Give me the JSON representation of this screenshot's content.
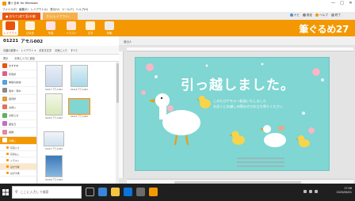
{
  "window": {
    "title": "筆ぐるめ for Windows",
    "controls": [
      "—",
      "□",
      "✕"
    ]
  },
  "menu": [
    "ファイル(F)",
    "編集(E)",
    "レイアウト(L)",
    "表示(V)",
    "ツール(T)",
    "ヘルプ(H)"
  ],
  "mode_tabs": [
    {
      "label": "● おもて(宛て面)を編集",
      "active": true
    },
    {
      "label": "うら(レイアウト)",
      "active": false
    }
  ],
  "top_links": [
    {
      "label": "ナビ",
      "color": "#4a90d9"
    },
    {
      "label": "設定",
      "color": "#888888"
    },
    {
      "label": "ヘルプ",
      "color": "#f39800"
    },
    {
      "label": "終了",
      "color": "#999999"
    }
  ],
  "ribbon": {
    "buttons": [
      {
        "label": "レイアウト",
        "icon": "layout-icon",
        "color": "#e8540c",
        "active": true
      },
      {
        "label": "ひな形",
        "icon": "template-icon",
        "color": "#e8540c",
        "active": false
      },
      {
        "label": "写真",
        "icon": "photo-icon",
        "color": "#d23f7a",
        "active": false
      },
      {
        "label": "イラスト",
        "icon": "illust-icon",
        "color": "#d24a2c",
        "active": false
      },
      {
        "label": "文字",
        "icon": "text-icon",
        "color": "#7a4a2a",
        "active": false
      },
      {
        "label": "印刷",
        "icon": "print-icon",
        "color": "#3a3a3a",
        "active": false
      }
    ],
    "brand": "筆ぐるめ27"
  },
  "layout": {
    "number": "01221",
    "name": "アモル002"
  },
  "right_caption": "差出人",
  "subtoolbar": [
    "引越の挨拶 ▾",
    "レイアウト ▾",
    "手書き文字",
    "お気に入り",
    "すべて"
  ],
  "subtoolbar2": [
    "表示",
    "お気に入りに追加"
  ],
  "categories": [
    {
      "label": "おすすめ",
      "color": "#e8540c",
      "sel": false,
      "sub": false
    },
    {
      "label": "年賀状",
      "color": "#e06080",
      "sel": false,
      "sub": false
    },
    {
      "label": "季節の挨拶",
      "color": "#5aa0d8",
      "sel": false,
      "sub": false
    },
    {
      "label": "喪中・寒中",
      "color": "#8a8a8a",
      "sel": false,
      "sub": false
    },
    {
      "label": "招待状",
      "color": "#d8a040",
      "sel": false,
      "sub": false
    },
    {
      "label": "お祝い",
      "color": "#e07060",
      "sel": false,
      "sub": false
    },
    {
      "label": "お知らせ",
      "color": "#60b060",
      "sel": false,
      "sub": false
    },
    {
      "label": "誕生日",
      "color": "#c070c0",
      "sel": false,
      "sub": false
    },
    {
      "label": "結婚",
      "color": "#e08aa0",
      "sel": false,
      "sub": false
    },
    {
      "label": "引越し",
      "color": "#ffffff",
      "sel": true,
      "sub": false
    },
    {
      "label": "写真入り",
      "color": "#f39800",
      "sel": false,
      "sub": true
    },
    {
      "label": "写真なし",
      "color": "#f39800",
      "sel": false,
      "sub": true
    },
    {
      "label": "イラスト",
      "color": "#f39800",
      "sel": false,
      "sub": true
    },
    {
      "label": "はがき縦",
      "color": "#f39800",
      "sel": false,
      "sub": true,
      "subsel": true
    },
    {
      "label": "はがき横",
      "color": "#f39800",
      "sel": false,
      "sub": true
    }
  ],
  "thumbnails": [
    {
      "caption": "01217 アモル001",
      "bg": "#e8eef6",
      "land": false,
      "sel": false
    },
    {
      "caption": "01218 アモル001",
      "bg": "#dff0f4",
      "land": false,
      "sel": false
    },
    {
      "caption": "01220 アモル002",
      "bg": "#f4f8e8",
      "land": false,
      "sel": false
    },
    {
      "caption": "01221 アモル002",
      "bg": "#7fd6d2",
      "land": true,
      "sel": true
    },
    {
      "caption": "01227 アモル003",
      "bg": "#f0f4f8",
      "land": true,
      "sel": false
    },
    {
      "caption": "01228 アモル003",
      "bg": "#3a78b8",
      "land": false,
      "sel": false
    }
  ],
  "card": {
    "headline": "引っ越しました。",
    "line1": "このたびアモルへ転居いたしました",
    "line2": "お近くにお越しの際はぜひお立ち寄りください",
    "bg": "#7fd6d2"
  },
  "taskbar": {
    "search_placeholder": "ここに入力して検索",
    "time": "17:08",
    "date": "2020/06/01"
  }
}
